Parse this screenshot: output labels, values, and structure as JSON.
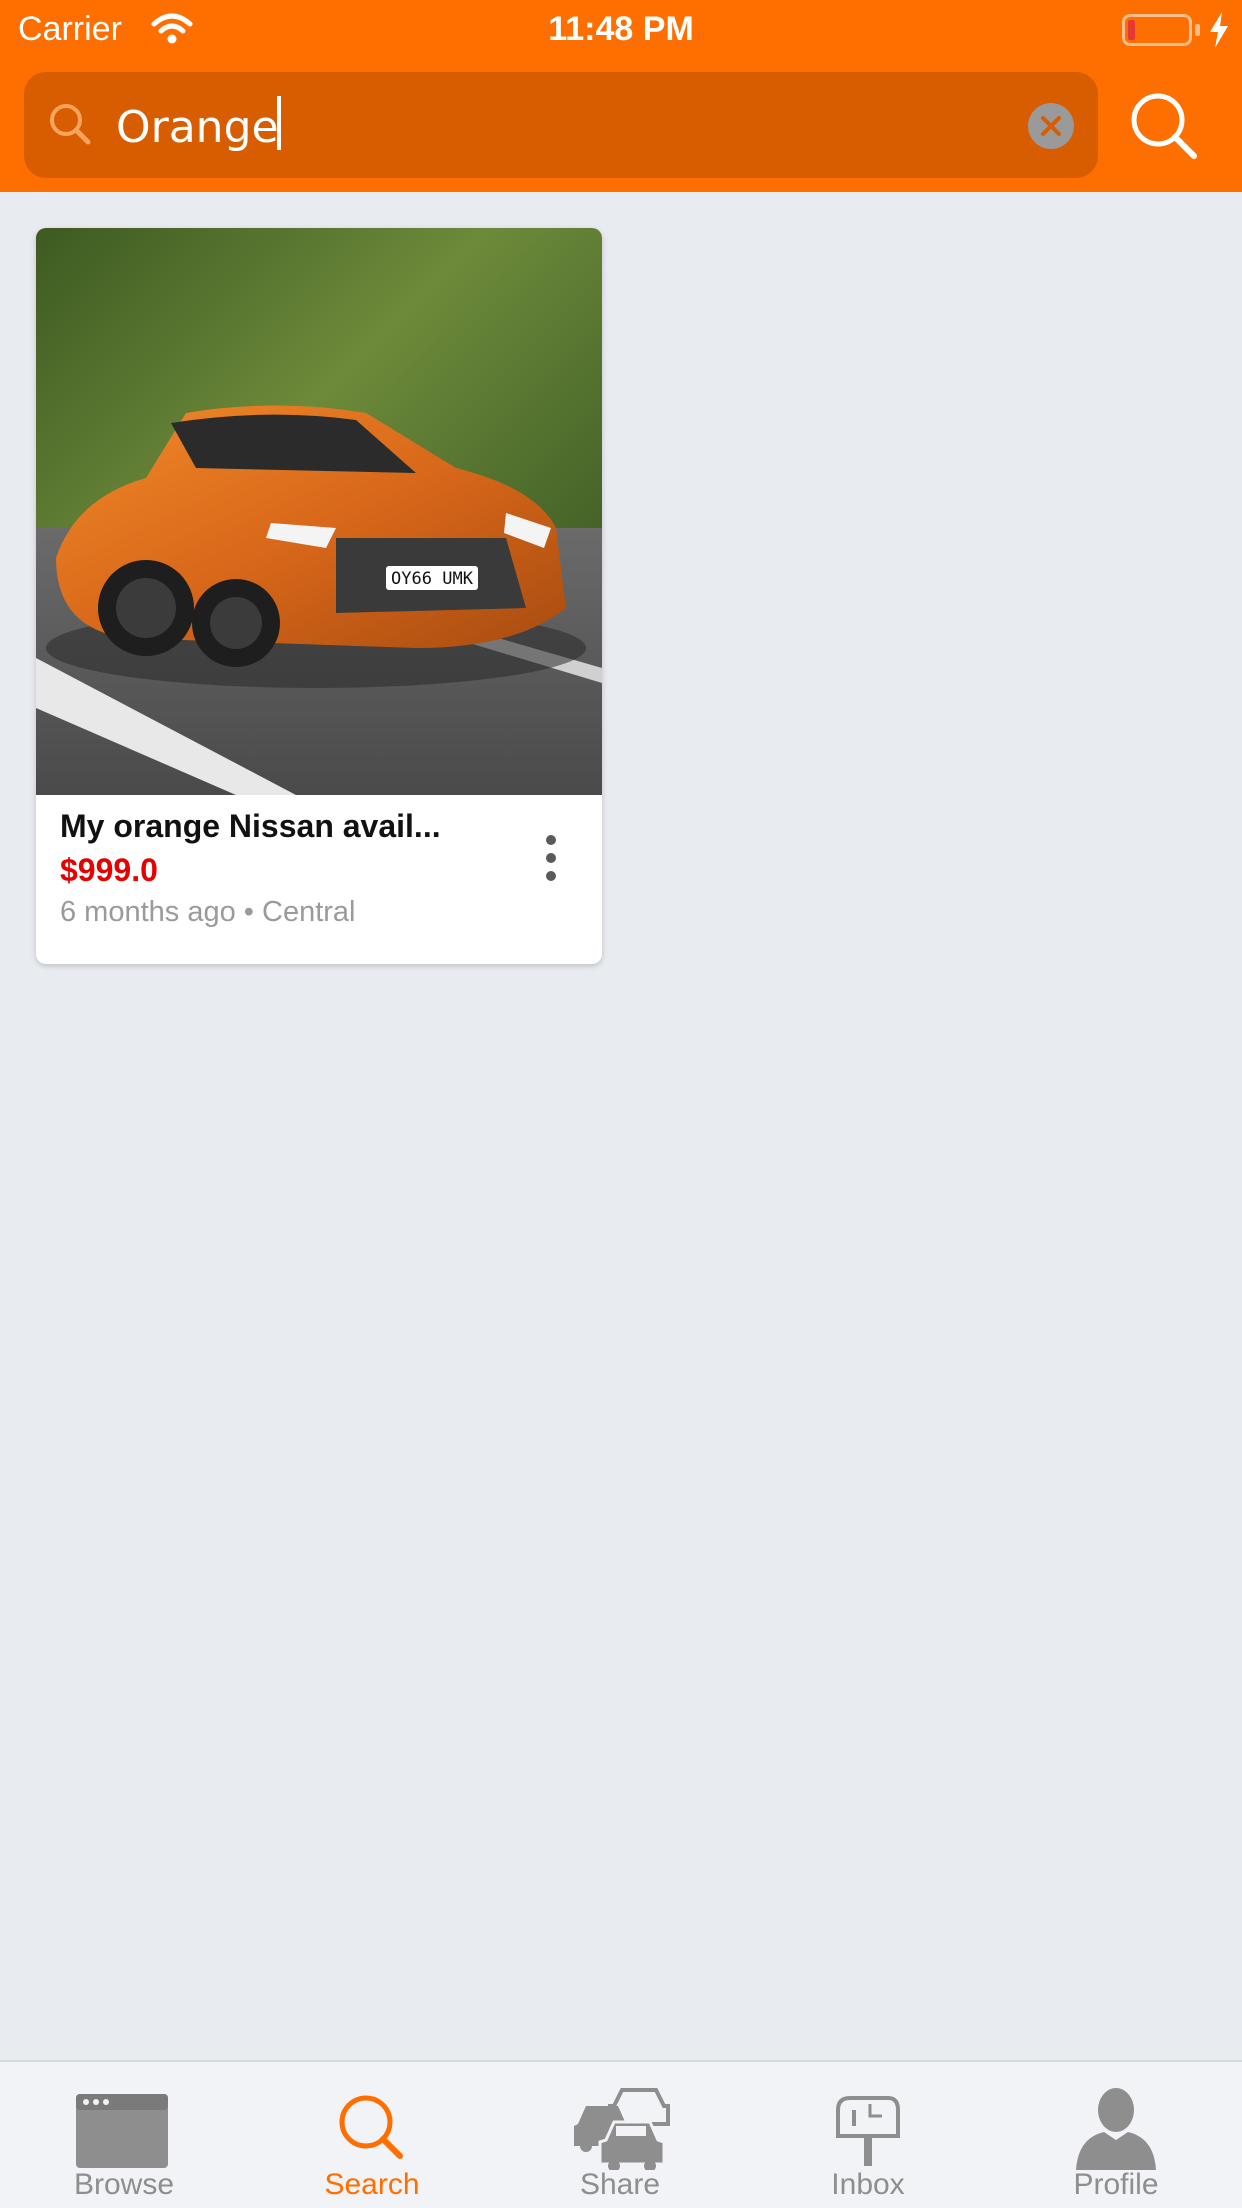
{
  "status_bar": {
    "carrier": "Carrier",
    "time": "11:48 PM"
  },
  "search": {
    "query": "Orange",
    "placeholder": "Search"
  },
  "results": [
    {
      "title": "My orange Nissan avail...",
      "price": "$999.0",
      "age": "6 months ago",
      "separator": "•",
      "location": "Central",
      "image": "orange-nissan-gtr-photo"
    }
  ],
  "tabs": [
    {
      "label": "Browse",
      "icon": "browser-window-icon",
      "active": false
    },
    {
      "label": "Search",
      "icon": "search-icon",
      "active": true
    },
    {
      "label": "Share",
      "icon": "cars-icon",
      "active": false
    },
    {
      "label": "Inbox",
      "icon": "mailbox-icon",
      "active": false
    },
    {
      "label": "Profile",
      "icon": "person-icon",
      "active": false
    }
  ],
  "colors": {
    "accent": "#ff6f00",
    "search_field": "#d85d00",
    "price": "#e60000",
    "background": "#e8ebf0",
    "tab_inactive": "#8e8e8e"
  }
}
